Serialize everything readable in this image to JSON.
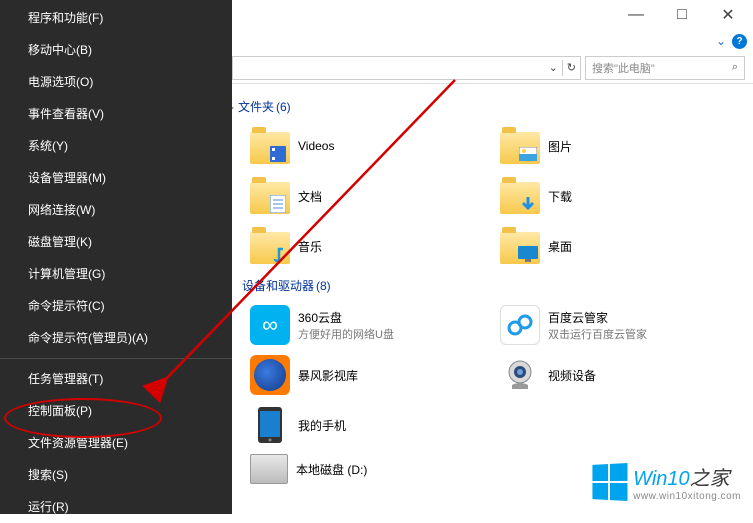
{
  "context_menu": {
    "items": [
      "程序和功能(F)",
      "移动中心(B)",
      "电源选项(O)",
      "事件查看器(V)",
      "系统(Y)",
      "设备管理器(M)",
      "网络连接(W)",
      "磁盘管理(K)",
      "计算机管理(G)",
      "命令提示符(C)",
      "命令提示符(管理员)(A)"
    ],
    "items2": [
      "任务管理器(T)",
      "控制面板(P)",
      "文件资源管理器(E)",
      "搜索(S)",
      "运行(R)"
    ]
  },
  "titlebar": {
    "minimize": "—",
    "maximize": "□",
    "close": "✕",
    "chevron": "⌄",
    "help": "?"
  },
  "address": {
    "dropdown": "⌄",
    "refresh": "↻"
  },
  "search": {
    "placeholder": "搜索\"此电脑\"",
    "icon": "🔍"
  },
  "sections": {
    "folders": {
      "label": "文件夹",
      "count": "(6)"
    },
    "devices": {
      "label": "设备和驱动器",
      "count": "(8)"
    }
  },
  "folders": [
    {
      "name": "Videos",
      "overlay_color": "#2e6bd6",
      "overlay": "film"
    },
    {
      "name": "图片",
      "overlay_color": "#3aa3e0",
      "overlay": "image"
    },
    {
      "name": "文档",
      "overlay_color": "#4a8cd8",
      "overlay": "doc"
    },
    {
      "name": "下载",
      "overlay_color": "#1e90e8",
      "overlay": "down"
    },
    {
      "name": "音乐",
      "overlay_color": "#1a9ad8",
      "overlay": "music"
    },
    {
      "name": "桌面",
      "overlay_color": "#1a88d0",
      "overlay": "desk"
    }
  ],
  "devices": [
    {
      "name": "360云盘",
      "sub": "方便好用的网络U盘",
      "bg": "#00b2ef",
      "glyph": "∞"
    },
    {
      "name": "百度云管家",
      "sub": "双击运行百度云管家",
      "bg": "#1e9cea",
      "glyph": "☁"
    },
    {
      "name": "暴风影视库",
      "sub": "",
      "bg": "#2a64c8",
      "glyph": "▶"
    },
    {
      "name": "视频设备",
      "sub": "",
      "bg": "#888",
      "glyph": "📷"
    },
    {
      "name": "我的手机",
      "sub": "",
      "bg": "#1b7fcf",
      "glyph": "📱"
    }
  ],
  "disk": {
    "label": "本地磁盘 (D:)"
  },
  "watermark": {
    "brand_a": "Win10",
    "brand_b": "之家",
    "url": "www.win10xitong.com"
  }
}
